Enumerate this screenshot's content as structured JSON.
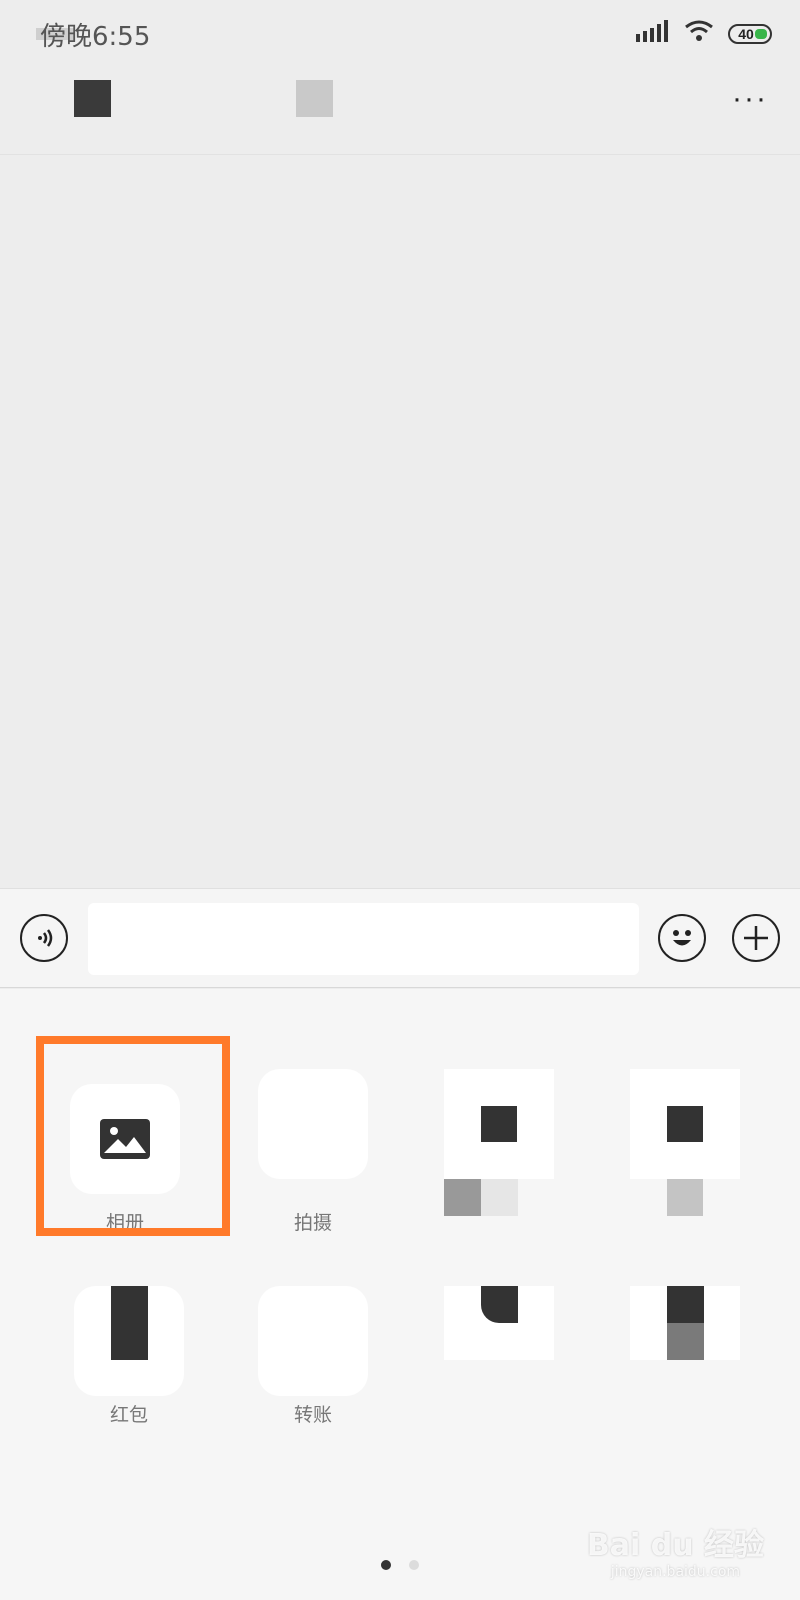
{
  "status_bar": {
    "time": "傍晚6:55",
    "battery": "40",
    "icons": [
      "signal-icon",
      "wifi-icon",
      "battery-icon"
    ]
  },
  "top_bar": {
    "more_label": "···"
  },
  "input_bar": {
    "text_value": "",
    "icons": [
      "voice-icon",
      "emoji-icon",
      "plus-icon"
    ]
  },
  "panel": {
    "items": [
      {
        "label": "相册",
        "icon": "image-icon"
      },
      {
        "label": "拍摄",
        "icon": "camera-icon"
      },
      {
        "label": "",
        "icon": "video-call-icon"
      },
      {
        "label": "",
        "icon": "location-icon"
      },
      {
        "label": "红包",
        "icon": "red-packet-icon"
      },
      {
        "label": "转账",
        "icon": "transfer-icon"
      },
      {
        "label": "",
        "icon": "voice-input-icon"
      },
      {
        "label": "",
        "icon": "favorites-icon"
      }
    ],
    "page_count": 2,
    "current_page": 1
  },
  "watermark": {
    "main": "Bai du 经验",
    "sub": "jingyan.baidu.com"
  },
  "colors": {
    "highlight": "#ff7a2a",
    "battery_fill": "#39b54a"
  }
}
